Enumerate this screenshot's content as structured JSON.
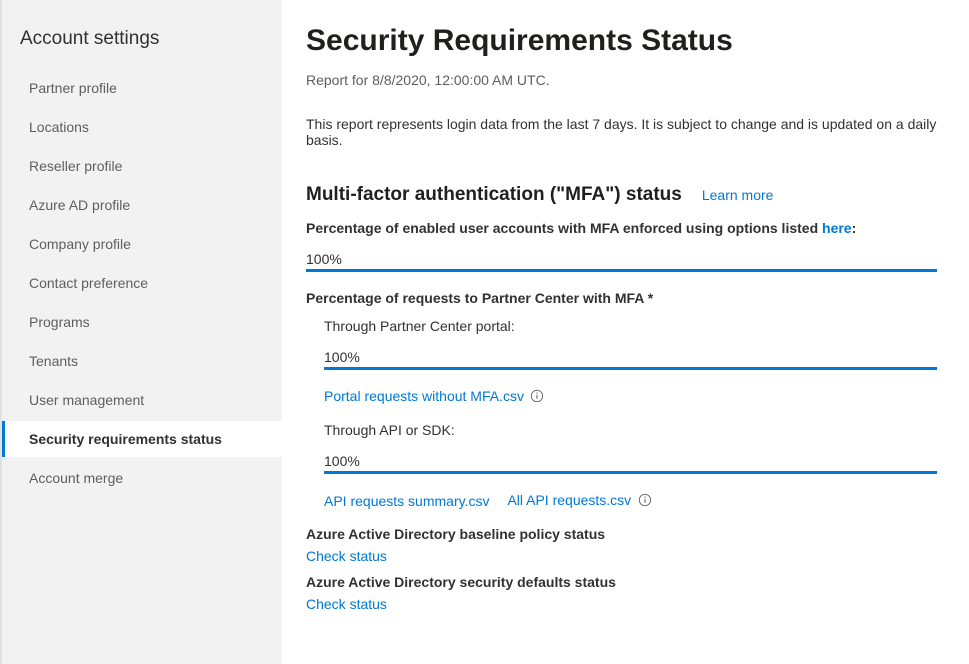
{
  "sidebar": {
    "title": "Account settings",
    "items": [
      {
        "label": "Partner profile"
      },
      {
        "label": "Locations"
      },
      {
        "label": "Reseller profile"
      },
      {
        "label": "Azure AD profile"
      },
      {
        "label": "Company profile"
      },
      {
        "label": "Contact preference"
      },
      {
        "label": "Programs"
      },
      {
        "label": "Tenants"
      },
      {
        "label": "User management"
      },
      {
        "label": "Security requirements status"
      },
      {
        "label": "Account merge"
      }
    ]
  },
  "main": {
    "title": "Security Requirements Status",
    "report_prefix": "Report for ",
    "report_timestamp": "8/8/2020, 12:00:00 AM UTC.",
    "description": "This report represents login data from the last 7 days. It is subject to change and is updated on a daily basis.",
    "mfa": {
      "heading": "Multi-factor authentication (\"MFA\") status",
      "learn_more": "Learn more",
      "enabled_label_pre": "Percentage of enabled user accounts with MFA enforced using options listed ",
      "enabled_label_link": "here",
      "enabled_label_post": ":",
      "enabled_value": "100%",
      "requests_label": "Percentage of requests to Partner Center with MFA *",
      "portal_label": "Through Partner Center portal:",
      "portal_value": "100%",
      "portal_csv": "Portal requests without MFA.csv",
      "api_label": "Through API or SDK:",
      "api_value": "100%",
      "api_summary_csv": "API requests summary.csv",
      "all_api_csv": "All API requests.csv"
    },
    "baseline": {
      "title": "Azure Active Directory baseline policy status",
      "link": "Check status"
    },
    "defaults": {
      "title": "Azure Active Directory security defaults status",
      "link": "Check status"
    }
  }
}
